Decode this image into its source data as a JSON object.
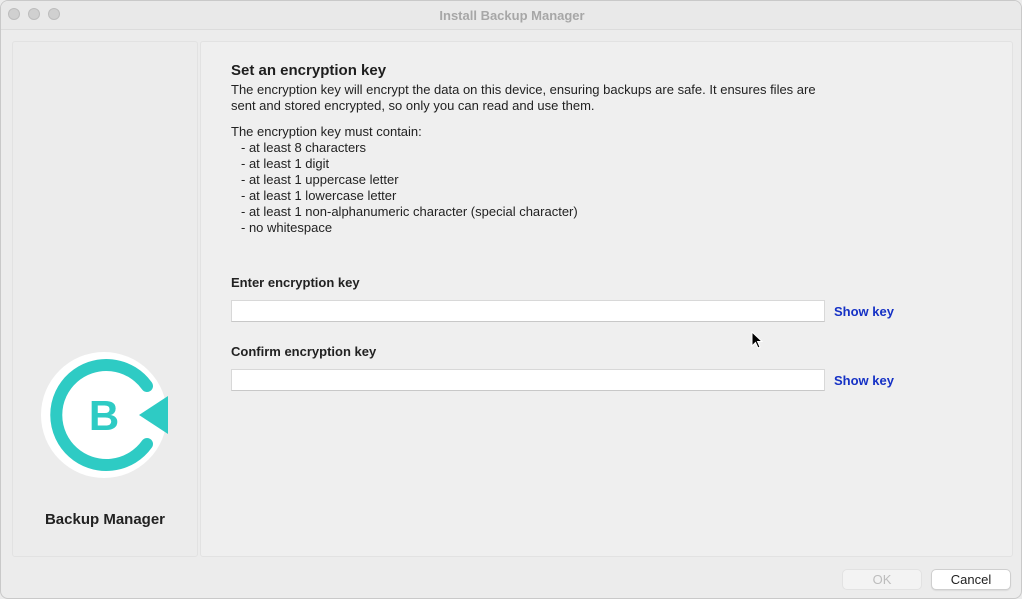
{
  "window": {
    "title": "Install Backup Manager"
  },
  "sidebar": {
    "logo_icon": "backup-manager-logo-icon",
    "logo_letter": "B",
    "brand_name": "Backup Manager",
    "accent_color": "#2ecbc4"
  },
  "main": {
    "heading": "Set an encryption key",
    "description": "The encryption key will encrypt the data on this device, ensuring backups are safe. It ensures files are sent and stored encrypted, so only you can read and use them.",
    "requirements_title": "The encryption key must contain:",
    "requirements": [
      "- at least 8 characters",
      "- at least 1 digit",
      "- at least 1 uppercase letter",
      "- at least 1 lowercase letter",
      "- at least 1 non-alphanumeric character (special character)",
      "- no whitespace"
    ],
    "enter_key": {
      "label": "Enter encryption key",
      "value": "",
      "show_label": "Show key"
    },
    "confirm_key": {
      "label": "Confirm encryption key",
      "value": "",
      "show_label": "Show key"
    }
  },
  "footer": {
    "ok_label": "OK",
    "cancel_label": "Cancel",
    "ok_enabled": false
  },
  "colors": {
    "link": "#1531c5",
    "disabled_text": "#bdbdbd"
  }
}
